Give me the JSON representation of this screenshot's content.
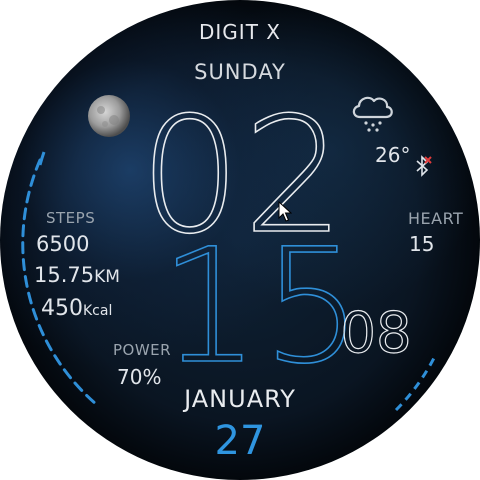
{
  "watch": {
    "title": "DIGIT X",
    "day": "SUNDAY",
    "time": {
      "hour": "02",
      "minute": "15",
      "seconds": "08"
    },
    "date": {
      "month": "JANUARY",
      "day": "27"
    }
  },
  "left_panel": {
    "steps_label": "STEPS",
    "steps_value": "6500",
    "distance_value": "15.75",
    "distance_unit": "KM",
    "calories_value": "450",
    "calories_unit": "Kcal",
    "power_label": "POWER",
    "power_value": "70%",
    "power_level": 0.7
  },
  "right_panel": {
    "weather_icon": "cloud-rain-icon",
    "temperature": "26°",
    "bluetooth_icon": "bluetooth-disconnected-icon",
    "heart_label": "HEART",
    "heart_value": "15"
  },
  "icons": {
    "moon": "moon-phase-icon",
    "cursor": "mouse-cursor-icon"
  },
  "colors": {
    "accent": "#2f8fd8",
    "text": "#e1e5ea",
    "label": "#9aa4ae",
    "bluetooth_off": "#e23b3b"
  }
}
